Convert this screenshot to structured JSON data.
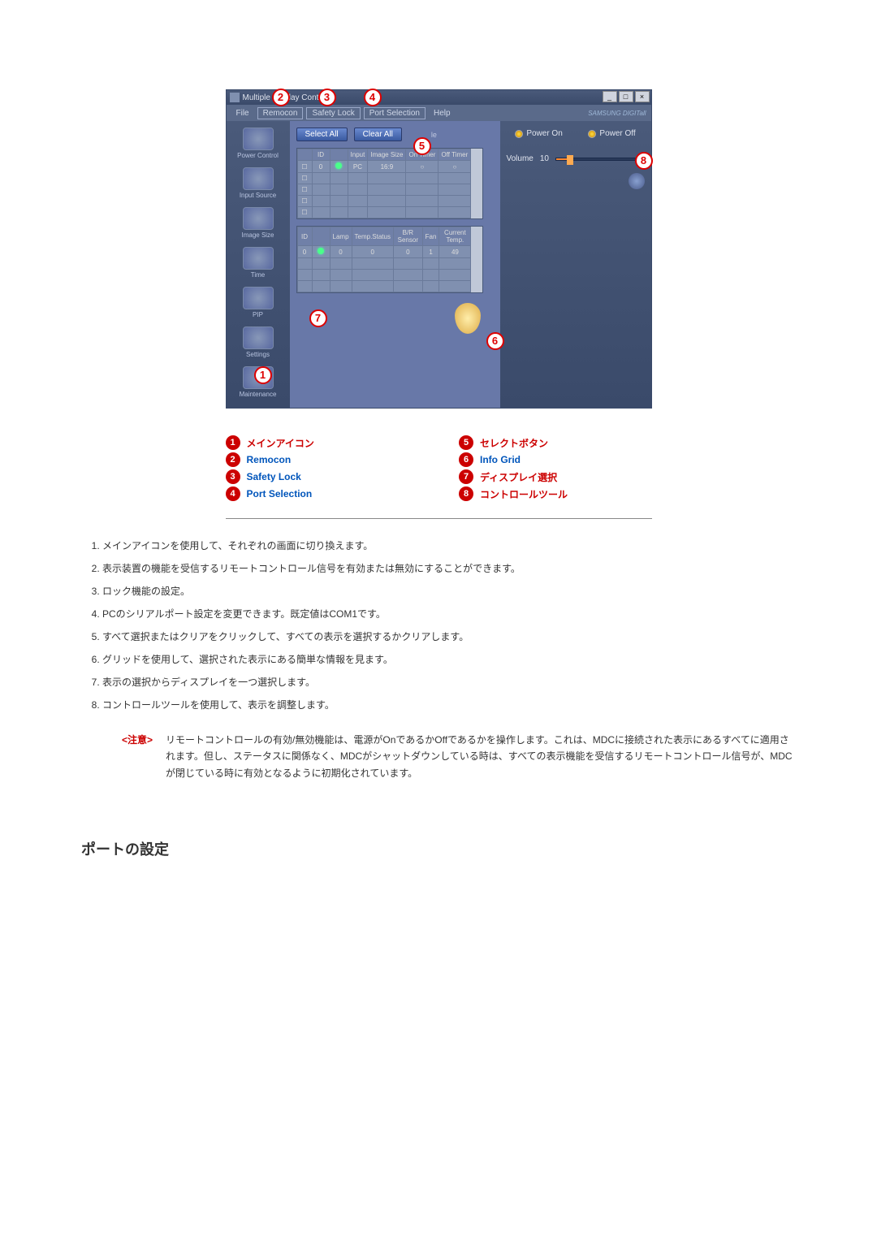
{
  "window": {
    "title": "Multiple Display Control",
    "brand": "SAMSUNG DIGITall"
  },
  "menu": {
    "file": "File",
    "remocon": "Remocon",
    "safety_lock": "Safety Lock",
    "port_selection": "Port Selection",
    "help": "Help"
  },
  "sidebar": {
    "power_control": "Power Control",
    "input_source": "Input Source",
    "image_size": "Image Size",
    "time": "Time",
    "pip": "PIP",
    "settings": "Settings",
    "maintenance": "Maintenance"
  },
  "toolbar": {
    "select_all": "Select All",
    "clear_all": "Clear All",
    "suffix": "le"
  },
  "grid1": {
    "headers": {
      "id": "ID",
      "input": "Input",
      "image_size": "Image Size",
      "on_timer": "On Timer",
      "off_timer": "Off Timer"
    },
    "rows": [
      {
        "id": "0",
        "input": "PC",
        "image_size": "16:9",
        "on": "○",
        "off": "○"
      }
    ]
  },
  "grid2": {
    "headers": {
      "id": "ID",
      "lamp": "Lamp",
      "temp": "Temp.Status",
      "br": "B/R Sensor",
      "fan": "Fan",
      "ctemp": "Current Temp."
    },
    "rows": [
      {
        "id": "0",
        "lamp": "0",
        "temp": "0",
        "br": "0",
        "fan": "1",
        "ctemp": "49"
      }
    ]
  },
  "power_panel": {
    "power_on": "Power On",
    "power_off": "Power Off",
    "volume_label": "Volume",
    "volume_value": "10"
  },
  "legend": {
    "1": "メインアイコン",
    "2": "Remocon",
    "3": "Safety Lock",
    "4": "Port Selection",
    "5": "セレクトボタン",
    "6": "Info Grid",
    "7": "ディスプレイ選択",
    "8": "コントロールツール"
  },
  "explanations": {
    "1": "メインアイコンを使用して、それぞれの画面に切り換えます。",
    "2": "表示装置の機能を受信するリモートコントロール信号を有効または無効にすることができます。",
    "3": "ロック機能の設定。",
    "4": "PCのシリアルポート設定を変更できます。既定値はCOM1です。",
    "5": "すべて選択またはクリアをクリックして、すべての表示を選択するかクリアします。",
    "6": "グリッドを使用して、選択された表示にある簡単な情報を見ます。",
    "7": "表示の選択からディスプレイを一つ選択します。",
    "8": "コントロールツールを使用して、表示を調整します。"
  },
  "note": {
    "label": "<注意>",
    "text": "リモートコントロールの有効/無効機能は、電源がOnであるかOffであるかを操作します。これは、MDCに接続された表示にあるすべてに適用されます。但し、ステータスに関係なく、MDCがシャットダウンしている時は、すべての表示機能を受信するリモートコントロール信号が、MDCが閉じている時に有効となるように初期化されています。"
  },
  "section_heading": "ポートの設定"
}
